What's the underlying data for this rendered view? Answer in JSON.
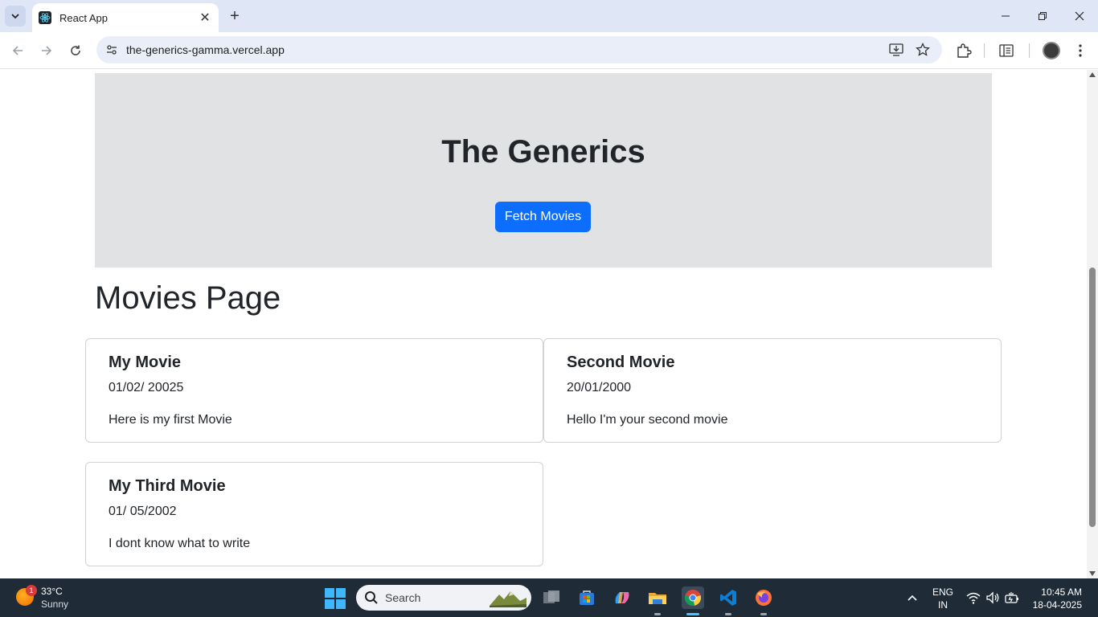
{
  "browser": {
    "tab": {
      "title": "React App"
    },
    "url": "the-generics-gamma.vercel.app"
  },
  "page": {
    "hero": {
      "title": "The Generics",
      "button_label": "Fetch Movies"
    },
    "heading": "Movies Page",
    "movies": [
      {
        "title": "My Movie",
        "date": "01/02/ 20025",
        "description": "Here is my first Movie"
      },
      {
        "title": "Second Movie",
        "date": "20/01/2000",
        "description": "Hello I'm your second movie"
      },
      {
        "title": "My Third Movie",
        "date": "01/ 05/2002",
        "description": "I dont know what to write"
      }
    ]
  },
  "taskbar": {
    "weather": {
      "badge": "1",
      "temp": "33°C",
      "condition": "Sunny"
    },
    "search_placeholder": "Search",
    "lang": {
      "line1": "ENG",
      "line2": "IN"
    },
    "time": "10:45 AM",
    "date": "18-04-2025"
  },
  "colors": {
    "primary_button": "#0d6efd",
    "hero_bg": "#e1e2e4",
    "taskbar_bg": "#1f2c38"
  }
}
